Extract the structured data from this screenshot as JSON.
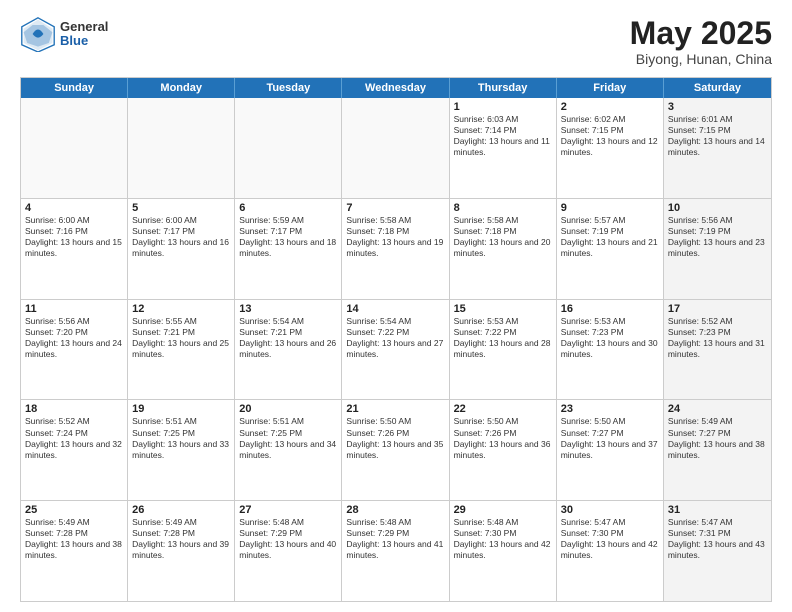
{
  "logo": {
    "general": "General",
    "blue": "Blue"
  },
  "title": {
    "month": "May 2025",
    "location": "Biyong, Hunan, China"
  },
  "weekdays": [
    "Sunday",
    "Monday",
    "Tuesday",
    "Wednesday",
    "Thursday",
    "Friday",
    "Saturday"
  ],
  "rows": [
    [
      {
        "day": "",
        "empty": true
      },
      {
        "day": "",
        "empty": true
      },
      {
        "day": "",
        "empty": true
      },
      {
        "day": "",
        "empty": true
      },
      {
        "day": "1",
        "sunrise": "6:03 AM",
        "sunset": "7:14 PM",
        "daylight": "13 hours and 11 minutes."
      },
      {
        "day": "2",
        "sunrise": "6:02 AM",
        "sunset": "7:15 PM",
        "daylight": "13 hours and 12 minutes."
      },
      {
        "day": "3",
        "sunrise": "6:01 AM",
        "sunset": "7:15 PM",
        "daylight": "13 hours and 14 minutes.",
        "shaded": true
      }
    ],
    [
      {
        "day": "4",
        "sunrise": "6:00 AM",
        "sunset": "7:16 PM",
        "daylight": "13 hours and 15 minutes."
      },
      {
        "day": "5",
        "sunrise": "6:00 AM",
        "sunset": "7:17 PM",
        "daylight": "13 hours and 16 minutes."
      },
      {
        "day": "6",
        "sunrise": "5:59 AM",
        "sunset": "7:17 PM",
        "daylight": "13 hours and 18 minutes."
      },
      {
        "day": "7",
        "sunrise": "5:58 AM",
        "sunset": "7:18 PM",
        "daylight": "13 hours and 19 minutes."
      },
      {
        "day": "8",
        "sunrise": "5:58 AM",
        "sunset": "7:18 PM",
        "daylight": "13 hours and 20 minutes."
      },
      {
        "day": "9",
        "sunrise": "5:57 AM",
        "sunset": "7:19 PM",
        "daylight": "13 hours and 21 minutes."
      },
      {
        "day": "10",
        "sunrise": "5:56 AM",
        "sunset": "7:19 PM",
        "daylight": "13 hours and 23 minutes.",
        "shaded": true
      }
    ],
    [
      {
        "day": "11",
        "sunrise": "5:56 AM",
        "sunset": "7:20 PM",
        "daylight": "13 hours and 24 minutes."
      },
      {
        "day": "12",
        "sunrise": "5:55 AM",
        "sunset": "7:21 PM",
        "daylight": "13 hours and 25 minutes."
      },
      {
        "day": "13",
        "sunrise": "5:54 AM",
        "sunset": "7:21 PM",
        "daylight": "13 hours and 26 minutes."
      },
      {
        "day": "14",
        "sunrise": "5:54 AM",
        "sunset": "7:22 PM",
        "daylight": "13 hours and 27 minutes."
      },
      {
        "day": "15",
        "sunrise": "5:53 AM",
        "sunset": "7:22 PM",
        "daylight": "13 hours and 28 minutes."
      },
      {
        "day": "16",
        "sunrise": "5:53 AM",
        "sunset": "7:23 PM",
        "daylight": "13 hours and 30 minutes."
      },
      {
        "day": "17",
        "sunrise": "5:52 AM",
        "sunset": "7:23 PM",
        "daylight": "13 hours and 31 minutes.",
        "shaded": true
      }
    ],
    [
      {
        "day": "18",
        "sunrise": "5:52 AM",
        "sunset": "7:24 PM",
        "daylight": "13 hours and 32 minutes."
      },
      {
        "day": "19",
        "sunrise": "5:51 AM",
        "sunset": "7:25 PM",
        "daylight": "13 hours and 33 minutes."
      },
      {
        "day": "20",
        "sunrise": "5:51 AM",
        "sunset": "7:25 PM",
        "daylight": "13 hours and 34 minutes."
      },
      {
        "day": "21",
        "sunrise": "5:50 AM",
        "sunset": "7:26 PM",
        "daylight": "13 hours and 35 minutes."
      },
      {
        "day": "22",
        "sunrise": "5:50 AM",
        "sunset": "7:26 PM",
        "daylight": "13 hours and 36 minutes."
      },
      {
        "day": "23",
        "sunrise": "5:50 AM",
        "sunset": "7:27 PM",
        "daylight": "13 hours and 37 minutes."
      },
      {
        "day": "24",
        "sunrise": "5:49 AM",
        "sunset": "7:27 PM",
        "daylight": "13 hours and 38 minutes.",
        "shaded": true
      }
    ],
    [
      {
        "day": "25",
        "sunrise": "5:49 AM",
        "sunset": "7:28 PM",
        "daylight": "13 hours and 38 minutes."
      },
      {
        "day": "26",
        "sunrise": "5:49 AM",
        "sunset": "7:28 PM",
        "daylight": "13 hours and 39 minutes."
      },
      {
        "day": "27",
        "sunrise": "5:48 AM",
        "sunset": "7:29 PM",
        "daylight": "13 hours and 40 minutes."
      },
      {
        "day": "28",
        "sunrise": "5:48 AM",
        "sunset": "7:29 PM",
        "daylight": "13 hours and 41 minutes."
      },
      {
        "day": "29",
        "sunrise": "5:48 AM",
        "sunset": "7:30 PM",
        "daylight": "13 hours and 42 minutes."
      },
      {
        "day": "30",
        "sunrise": "5:47 AM",
        "sunset": "7:30 PM",
        "daylight": "13 hours and 42 minutes."
      },
      {
        "day": "31",
        "sunrise": "5:47 AM",
        "sunset": "7:31 PM",
        "daylight": "13 hours and 43 minutes.",
        "shaded": true
      }
    ]
  ]
}
